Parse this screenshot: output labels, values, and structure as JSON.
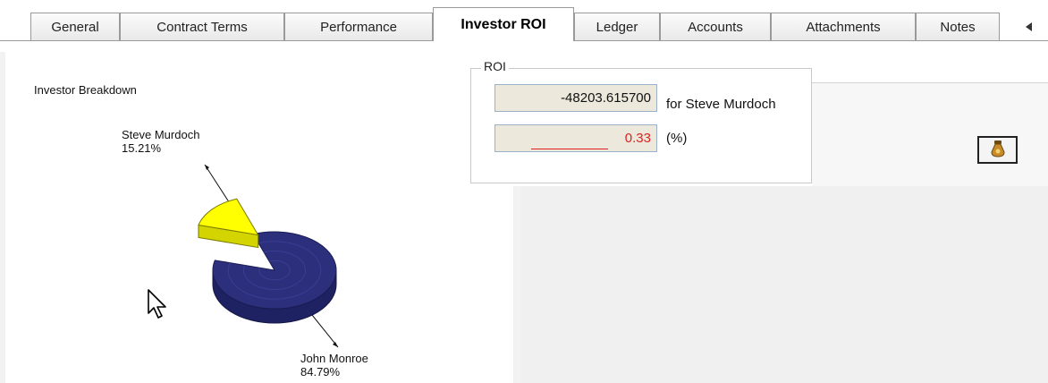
{
  "tabs": [
    {
      "label": "General",
      "active": false
    },
    {
      "label": "Contract Terms",
      "active": false
    },
    {
      "label": "Performance",
      "active": false
    },
    {
      "label": "Investor ROI",
      "active": true
    },
    {
      "label": "Ledger",
      "active": false
    },
    {
      "label": "Accounts",
      "active": false
    },
    {
      "label": "Attachments",
      "active": false
    },
    {
      "label": "Notes",
      "active": false
    }
  ],
  "tab_scroll_icon": "left-arrow-icon",
  "chart": {
    "title": "Investor Breakdown"
  },
  "chart_data": {
    "type": "pie",
    "title": "Investor Breakdown",
    "slices": [
      {
        "name": "Steve Murdoch",
        "percent_label": "15.21%",
        "value": 15.21,
        "color": "#ffff00",
        "exploded": true
      },
      {
        "name": "John Monroe",
        "percent_label": "84.79%",
        "value": 84.79,
        "color": "#2c2f7c",
        "exploded": false
      }
    ]
  },
  "roi": {
    "legend": "ROI",
    "amount_value": "-48203.615700",
    "amount_suffix": "for Steve Murdoch",
    "percent_value": "0.33",
    "percent_suffix": "(%)"
  },
  "toolbar": {
    "icon": "money-bag-icon"
  },
  "colors": {
    "pie_main": "#2c2f7c",
    "pie_highlight": "#ffff00",
    "percent_text": "#e02020"
  }
}
